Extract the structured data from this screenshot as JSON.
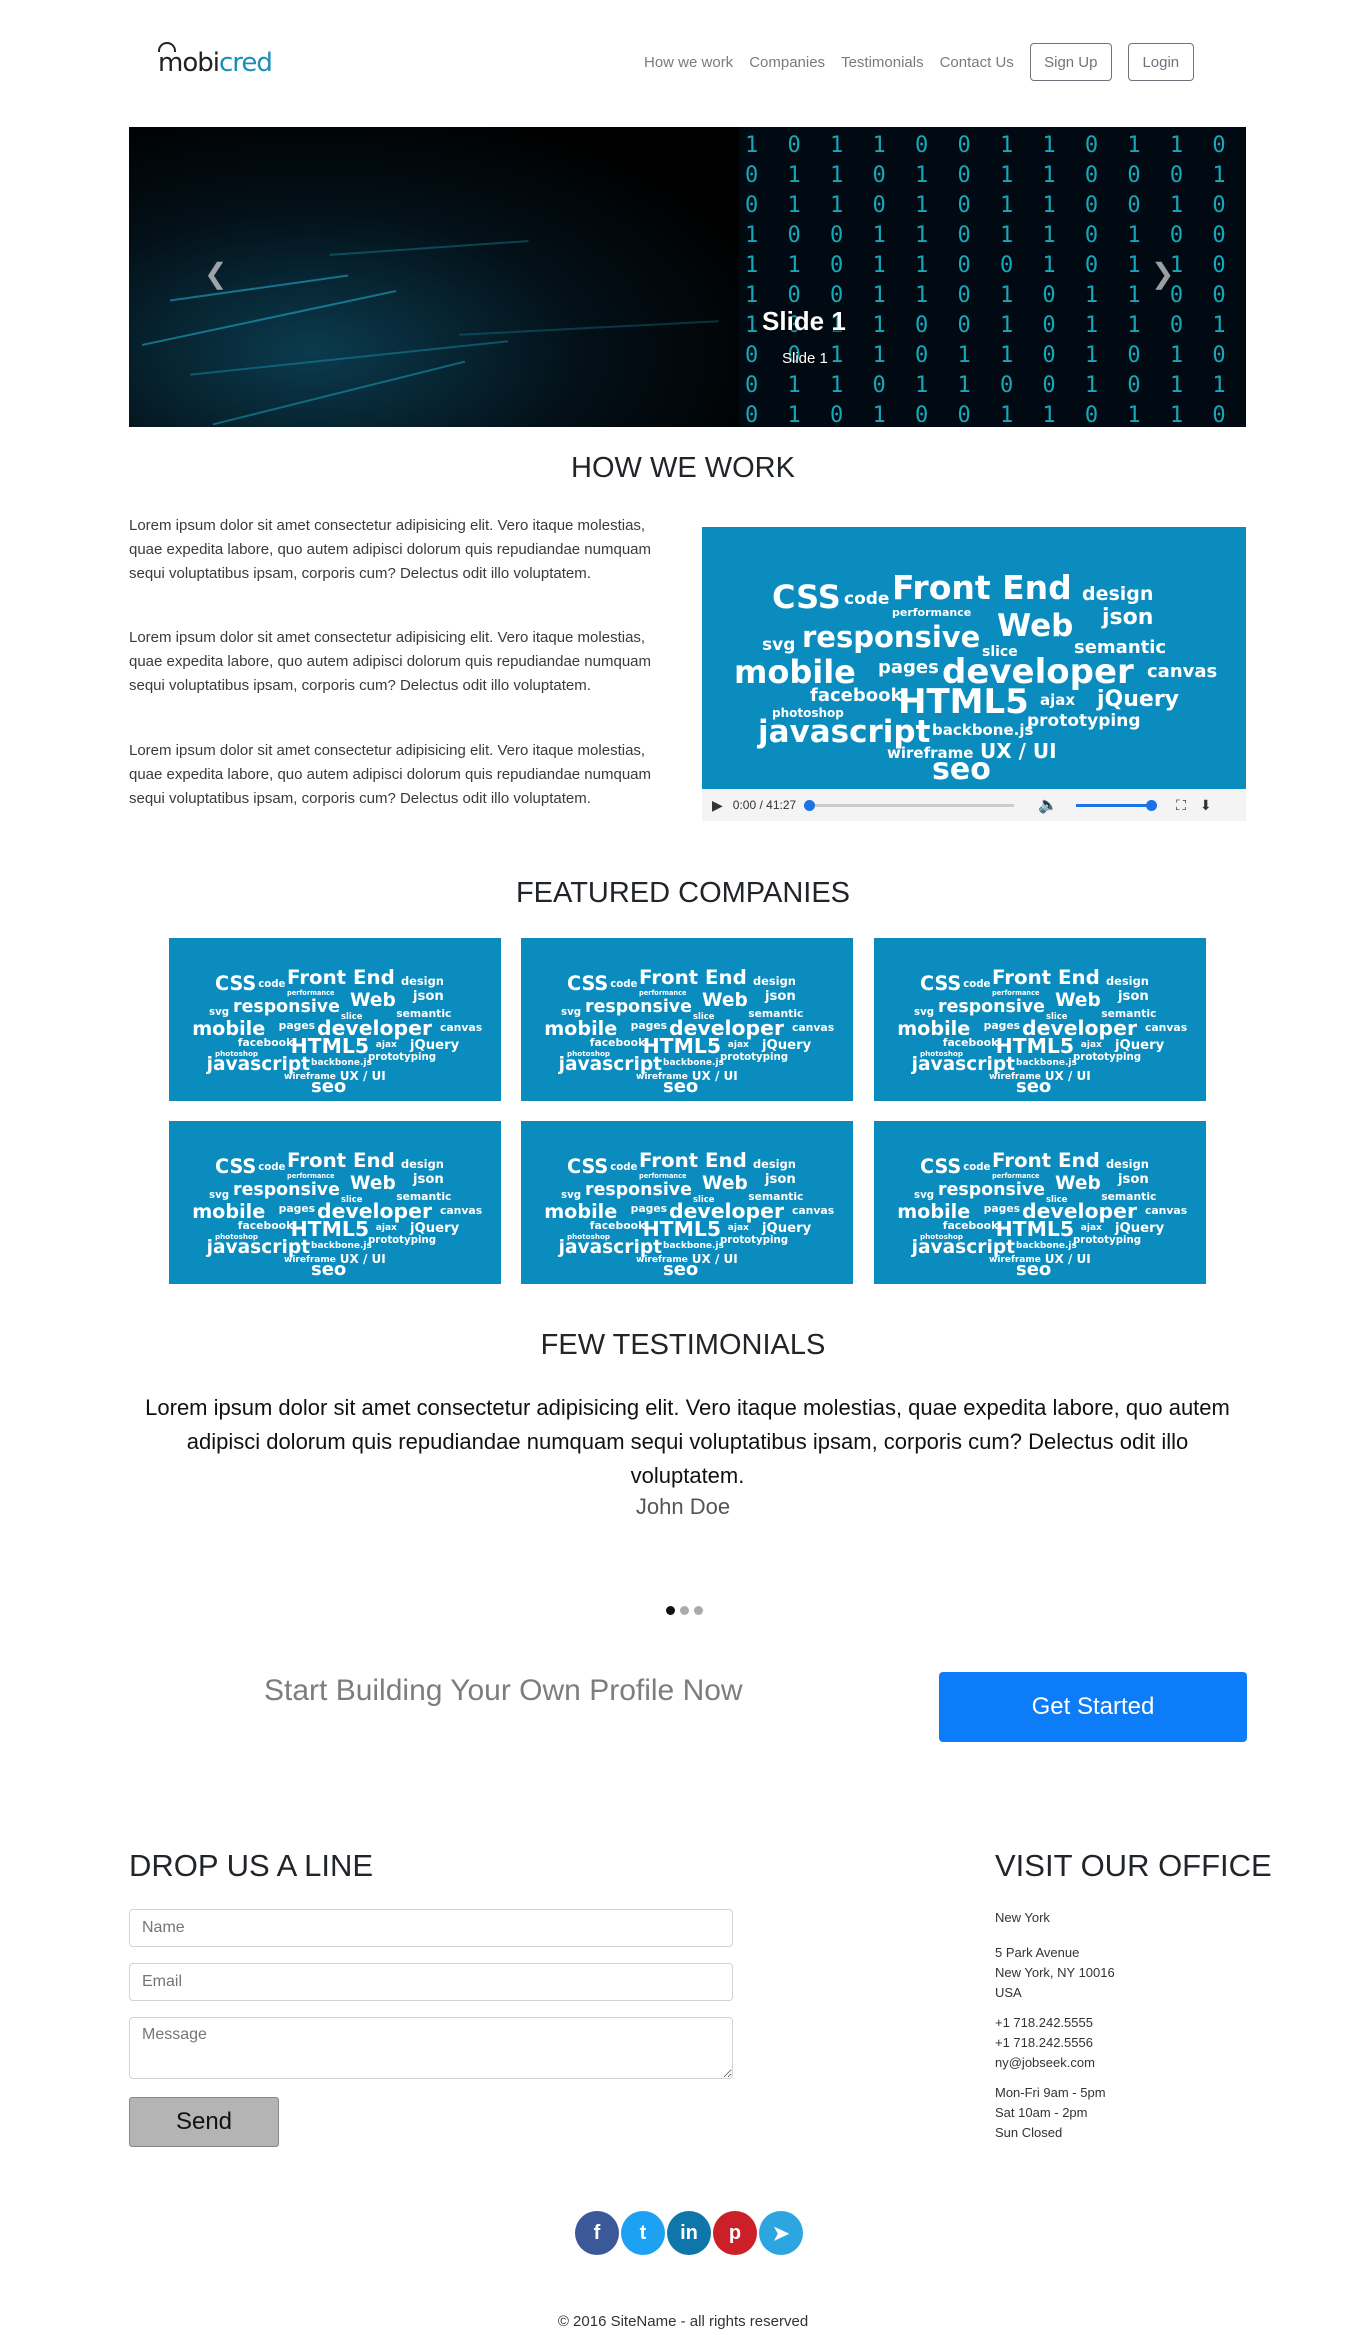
{
  "header": {
    "logo_part1": "mobi",
    "logo_part2": "cred",
    "nav": [
      "How we work",
      "Companies",
      "Testimonials",
      "Contact Us"
    ],
    "signup_label": "Sign Up",
    "login_label": "Login"
  },
  "carousel": {
    "caption_title": "Slide 1",
    "caption_text": "Slide 1",
    "prev_icon": "chevron-left-icon",
    "next_icon": "chevron-right-icon"
  },
  "how_we_work": {
    "heading": "HOW WE WORK",
    "paragraphs": [
      "Lorem ipsum dolor sit amet consectetur adipisicing elit. Vero itaque molestias, quae expedita labore, quo autem adipisci dolorum quis repudiandae numquam sequi voluptatibus ipsam, corporis cum? Delectus odit illo voluptatem.",
      "Lorem ipsum dolor sit amet consectetur adipisicing elit. Vero itaque molestias, quae expedita labore, quo autem adipisci dolorum quis repudiandae numquam sequi voluptatibus ipsam, corporis cum? Delectus odit illo voluptatem.",
      "Lorem ipsum dolor sit amet consectetur adipisicing elit. Vero itaque molestias, quae expedita labore, quo autem adipisci dolorum quis repudiandae numquam sequi voluptatibus ipsam, corporis cum? Delectus odit illo voluptatem."
    ],
    "video_time": "0:00 / 41:27",
    "video_progress": 0,
    "volume_level": 1.0
  },
  "word_cloud": [
    "CSS",
    "code",
    "Front End",
    "design",
    "performance",
    "responsive",
    "Web",
    "json",
    "svg",
    "slice",
    "semantic",
    "mobile",
    "pages",
    "developer",
    "canvas",
    "facebook",
    "HTML5",
    "ajax",
    "jQuery",
    "photoshop",
    "javascript",
    "backbone.js",
    "prototyping",
    "wireframe",
    "UX / UI",
    "seo"
  ],
  "companies": {
    "heading": "FEATURED COMPANIES",
    "tile_count": 6
  },
  "testimonials": {
    "heading": "FEW TESTIMONIALS",
    "quote": "Lorem ipsum dolor sit amet consectetur adipisicing elit. Vero itaque molestias, quae expedita labore, quo autem adipisci dolorum quis repudiandae numquam sequi voluptatibus ipsam, corporis cum? Delectus odit illo voluptatem.",
    "author": "John Doe",
    "active_index": 0,
    "dot_count": 3
  },
  "cta": {
    "text": "Start Building Your Own Profile Now",
    "button": "Get Started"
  },
  "contact": {
    "heading": "DROP US A LINE",
    "name_placeholder": "Name",
    "email_placeholder": "Email",
    "message_placeholder": "Message",
    "send_label": "Send"
  },
  "office": {
    "heading": "VISIT OUR OFFICE",
    "city": "New York",
    "address": [
      "5 Park Avenue",
      "New York, NY 10016",
      "USA"
    ],
    "contact": [
      "+1 718.242.5555",
      "+1 718.242.5556",
      "ny@jobseek.com"
    ],
    "hours": [
      "Mon-Fri 9am - 5pm",
      "Sat 10am - 2pm",
      "Sun Closed"
    ]
  },
  "social": [
    {
      "name": "facebook-icon",
      "glyph": "f",
      "color": "#3b5998"
    },
    {
      "name": "twitter-icon",
      "glyph": "t",
      "color": "#1da1f2"
    },
    {
      "name": "linkedin-icon",
      "glyph": "in",
      "color": "#0e76a8"
    },
    {
      "name": "pinterest-icon",
      "glyph": "p",
      "color": "#cb2027"
    },
    {
      "name": "telegram-icon",
      "glyph": "➤",
      "color": "#2ca5e0"
    }
  ],
  "footer": {
    "copyright": "© 2016 SiteName - all rights reserved"
  },
  "colors": {
    "brand": "#1a8fb6",
    "primary_button": "#0d7cf9",
    "tile_blue": "#0a8cbf"
  }
}
